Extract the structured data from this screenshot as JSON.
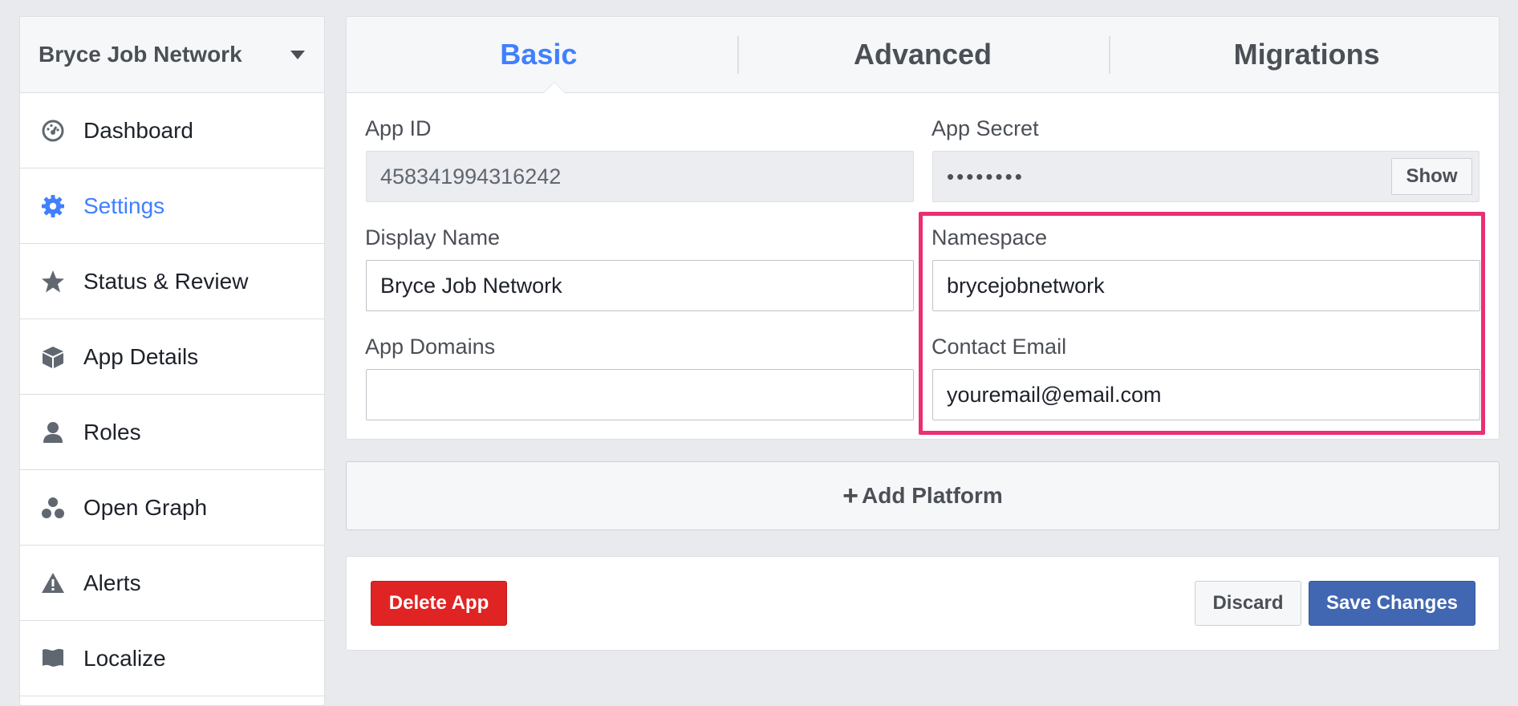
{
  "sidebar": {
    "app_name": "Bryce Job Network",
    "items": [
      {
        "label": "Dashboard",
        "icon": "dashboard-icon"
      },
      {
        "label": "Settings",
        "icon": "gear-icon",
        "active": true
      },
      {
        "label": "Status & Review",
        "icon": "star-icon"
      },
      {
        "label": "App Details",
        "icon": "cube-icon"
      },
      {
        "label": "Roles",
        "icon": "person-icon"
      },
      {
        "label": "Open Graph",
        "icon": "open-graph-icon"
      },
      {
        "label": "Alerts",
        "icon": "warning-icon"
      },
      {
        "label": "Localize",
        "icon": "flag-icon"
      }
    ]
  },
  "tabs": [
    {
      "label": "Basic",
      "active": true
    },
    {
      "label": "Advanced"
    },
    {
      "label": "Migrations"
    }
  ],
  "form": {
    "app_id": {
      "label": "App ID",
      "value": "458341994316242"
    },
    "app_secret": {
      "label": "App Secret",
      "value": "••••••••",
      "show_label": "Show"
    },
    "display_name": {
      "label": "Display Name",
      "value": "Bryce Job Network"
    },
    "namespace": {
      "label": "Namespace",
      "value": "brycejobnetwork"
    },
    "app_domains": {
      "label": "App Domains",
      "value": ""
    },
    "contact_email": {
      "label": "Contact Email",
      "value": "youremail@email.com"
    }
  },
  "add_platform": {
    "plus": "+",
    "label": "Add Platform"
  },
  "actions": {
    "delete_label": "Delete App",
    "discard_label": "Discard",
    "save_label": "Save Changes"
  },
  "colors": {
    "accent": "#4080ff",
    "highlight": "#ea2f72",
    "danger": "#e02424",
    "primary": "#4267b2"
  }
}
